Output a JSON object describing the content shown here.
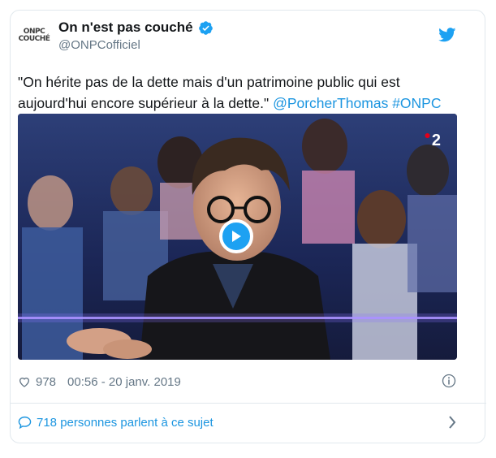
{
  "tweet": {
    "avatar_text_line1": "ONPC",
    "avatar_text_line2": "COUCHÉ",
    "author_name": "On n'est pas couché",
    "handle": "@ONPCofficiel",
    "text": "\"On hérite pas de la dette mais d'un patrimoine public qui est aujourd'hui encore supérieur à la dette.\" ",
    "mention": "@PorcherThomas",
    "hashtag": "#ONPC",
    "video": {
      "channel_logo": "2"
    },
    "likes": "978",
    "timestamp": "00:56 - 20 janv. 2019",
    "conversation": "718 personnes parlent à ce sujet"
  },
  "icons": {
    "verified": "verified-badge-icon",
    "bird": "twitter-bird-icon",
    "heart": "heart-icon",
    "info": "info-icon",
    "bubble": "speech-bubble-icon",
    "chevron": "chevron-right-icon",
    "play": "play-icon"
  },
  "colors": {
    "accent": "#1da1f2",
    "link": "#1b95e0",
    "muted": "#657786"
  }
}
